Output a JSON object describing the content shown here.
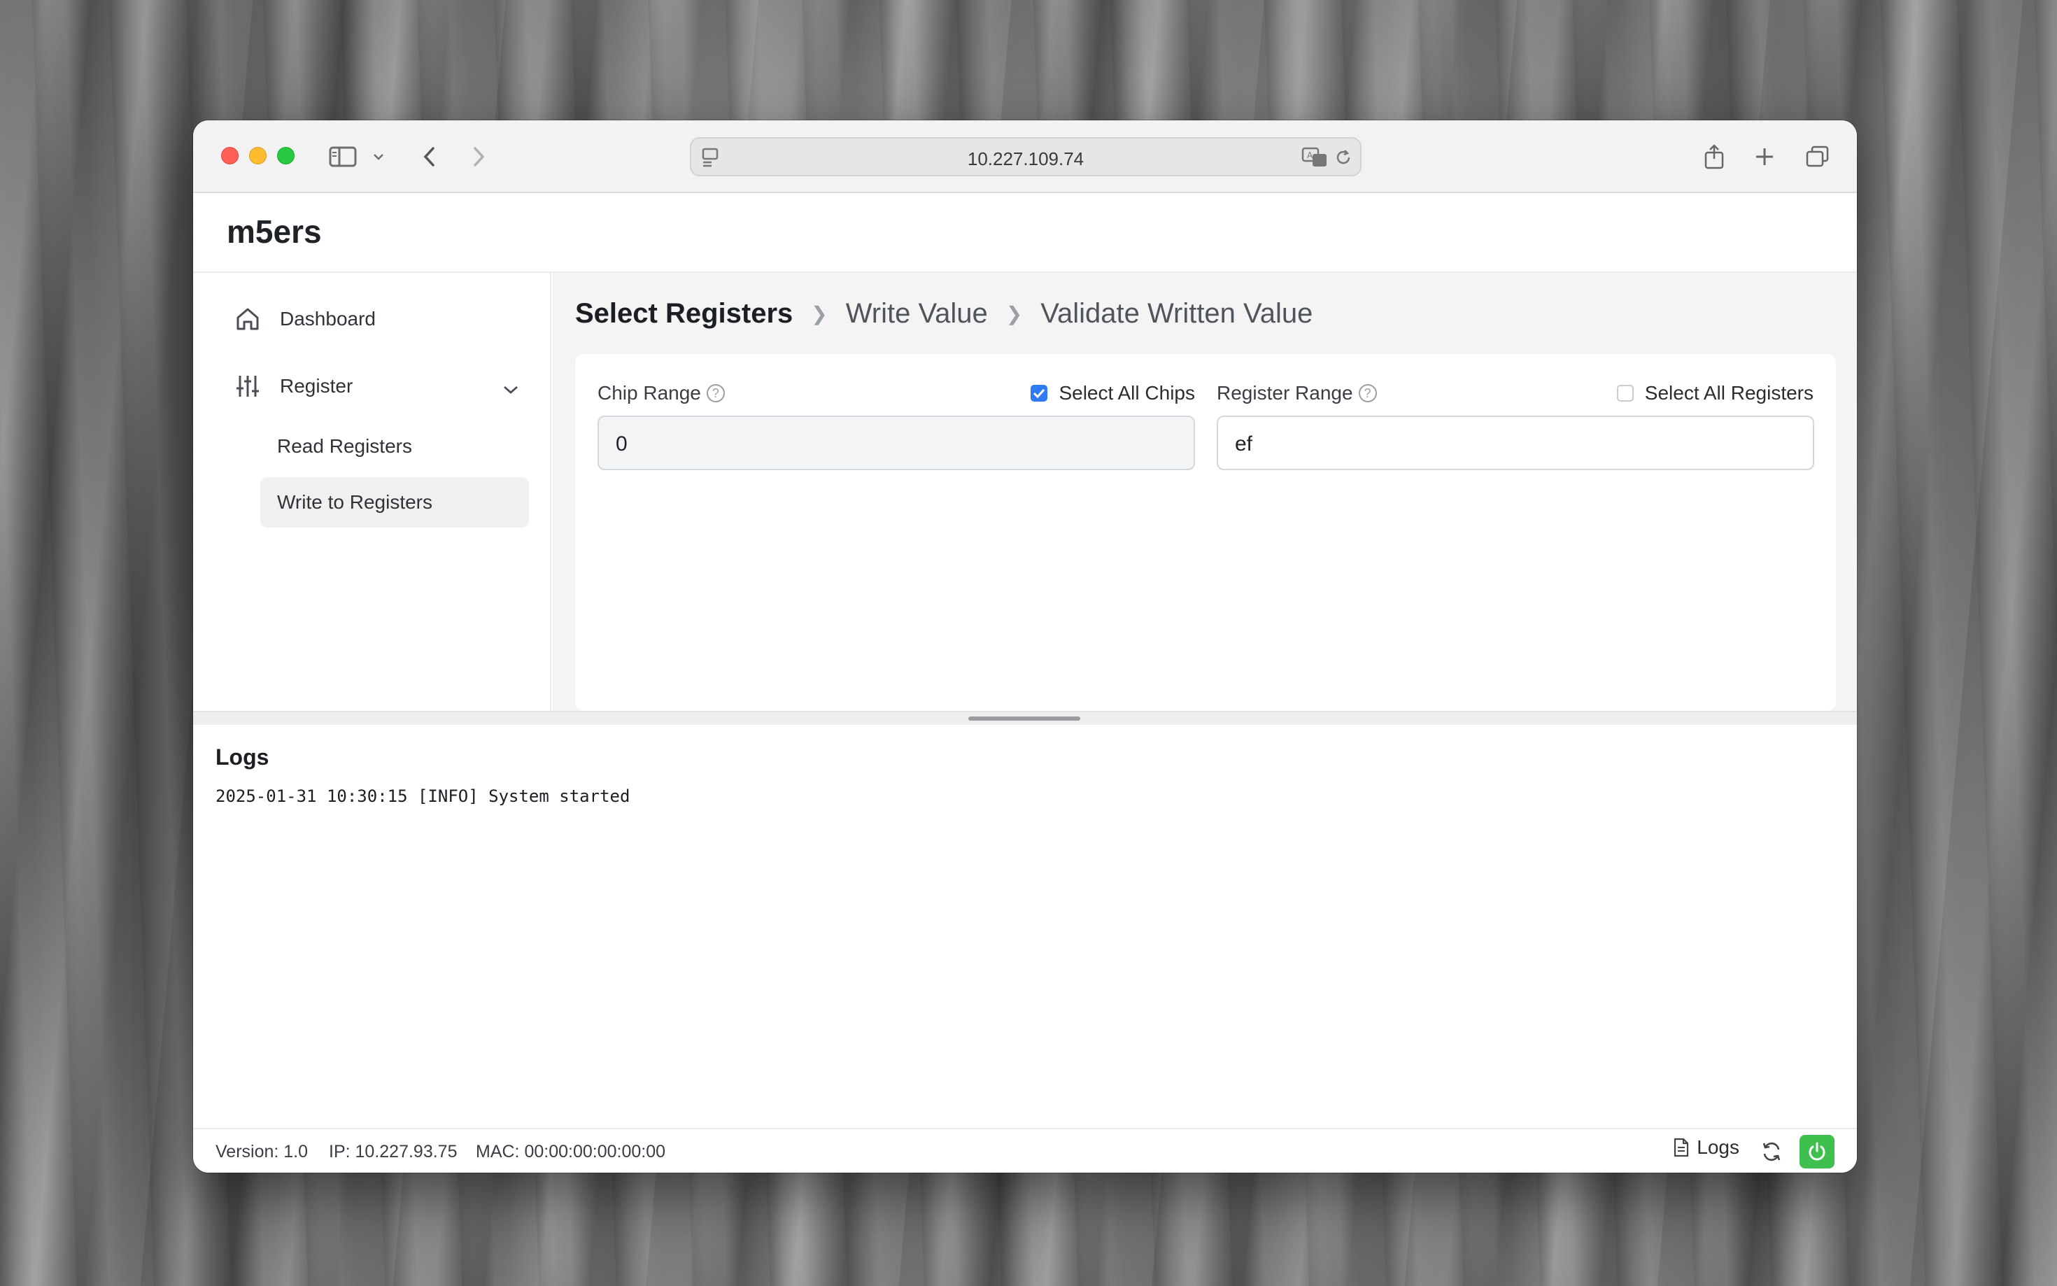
{
  "browser": {
    "url": "10.227.109.74"
  },
  "app": {
    "brand": "m5ers"
  },
  "sidebar": {
    "items": [
      {
        "label": "Dashboard",
        "icon": "home-icon"
      },
      {
        "label": "Register",
        "icon": "sliders-icon",
        "expanded": true
      }
    ],
    "sub_items": [
      {
        "label": "Read Registers",
        "active": false
      },
      {
        "label": "Write to Registers",
        "active": true
      }
    ]
  },
  "steps": [
    {
      "label": "Select Registers",
      "current": true
    },
    {
      "label": "Write Value",
      "current": false
    },
    {
      "label": "Validate Written Value",
      "current": false
    }
  ],
  "form": {
    "chip_range": {
      "label": "Chip Range",
      "value": "0",
      "select_all_label": "Select All Chips",
      "select_all_checked": true
    },
    "register_range": {
      "label": "Register Range",
      "value": "ef",
      "select_all_label": "Select All Registers",
      "select_all_checked": false
    }
  },
  "logs": {
    "title": "Logs",
    "lines": [
      "2025-01-31 10:30:15 [INFO] System started"
    ]
  },
  "footer": {
    "version": "Version: 1.0",
    "ip": "IP: 10.227.93.75",
    "mac": "MAC: 00:00:00:00:00:00",
    "logs_label": "Logs"
  },
  "colors": {
    "accent": "#2f7bf6",
    "power": "#3fbf4e"
  }
}
